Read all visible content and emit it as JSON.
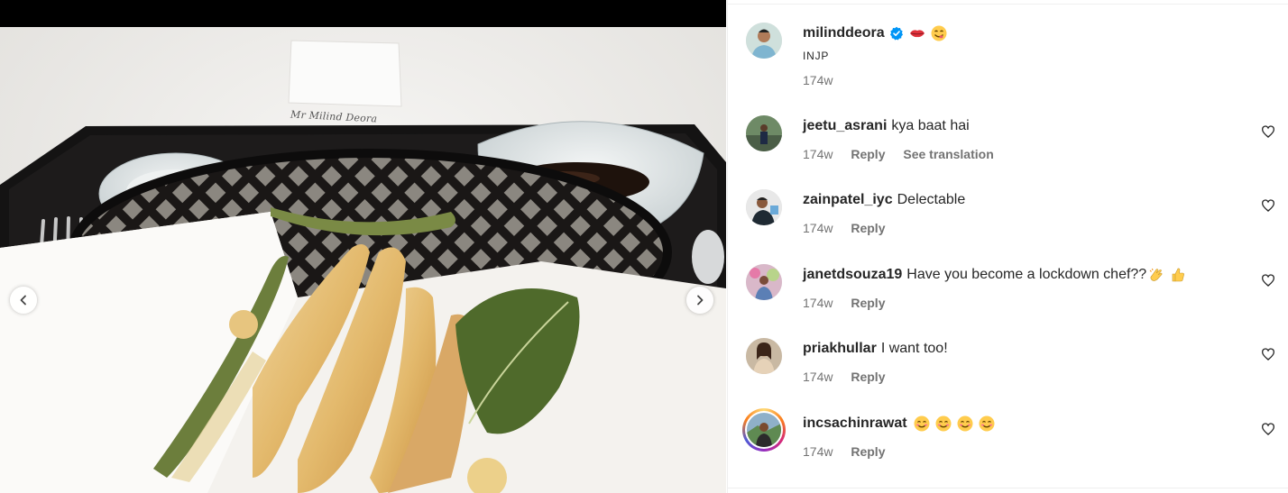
{
  "post": {
    "author": "milinddeora",
    "caption": "INJP",
    "time": "174w",
    "place_card": "Mr Milind Deora"
  },
  "comments": [
    {
      "username": "jeetu_asrani",
      "text": "kya baat hai",
      "time": "174w",
      "reply": "Reply",
      "translate": "See translation"
    },
    {
      "username": "zainpatel_iyc",
      "text": "Delectable",
      "time": "174w",
      "reply": "Reply"
    },
    {
      "username": "janetdsouza19",
      "text": "Have you become a lockdown chef??",
      "time": "174w",
      "reply": "Reply"
    },
    {
      "username": "priakhullar",
      "text": "I want too!",
      "time": "174w",
      "reply": "Reply"
    },
    {
      "username": "incsachinrawat",
      "text": "",
      "time": "174w",
      "reply": "Reply"
    }
  ],
  "colors": {
    "verified": "#0095f6",
    "meta_text": "#737373",
    "divider": "#efefef"
  },
  "icons": {
    "prev": "chevron-left-icon",
    "next": "chevron-right-icon",
    "like": "heart-outline-icon",
    "verified": "verified-badge-icon"
  }
}
